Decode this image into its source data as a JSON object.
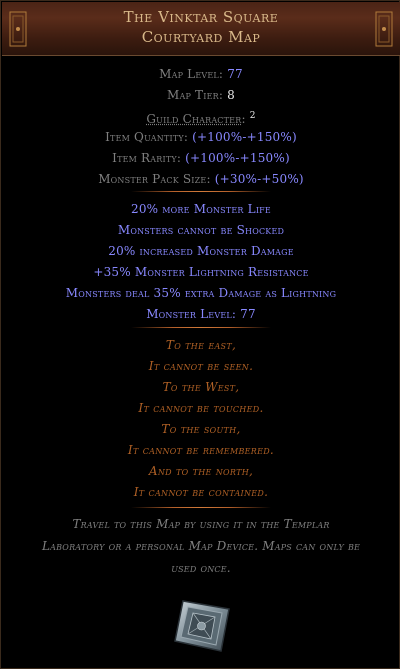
{
  "title": {
    "line1": "The Vinktar Square",
    "line2": "Courtyard Map"
  },
  "properties": [
    {
      "label": "Map Level: ",
      "value": "77",
      "value_color": "blue"
    },
    {
      "label": "Map Tier: ",
      "value": "8",
      "value_color": "white"
    },
    {
      "label": "Guild Character",
      "value": "2",
      "kind": "guild"
    },
    {
      "label": "Item Quantity: ",
      "value": "(+100%-+150%)",
      "value_color": "blue"
    },
    {
      "label": "Item Rarity: ",
      "value": "(+100%-+150%)",
      "value_color": "blue"
    },
    {
      "label": "Monster Pack Size: ",
      "value": "(+30%-+50%)",
      "value_color": "blue"
    }
  ],
  "mods": [
    "20% more Monster Life",
    "Monsters cannot be Shocked",
    "20% increased Monster Damage",
    "+35% Monster Lightning Resistance",
    "Monsters deal 35% extra Damage as Lightning",
    "Monster Level: 77"
  ],
  "flavour": [
    "To the east,",
    "It cannot be seen.",
    "To the West,",
    "It cannot be touched.",
    "To the south,",
    "It cannot be remembered.",
    "And to the north,",
    "It cannot be contained."
  ],
  "description": [
    "Travel to this Map by using it in the Templar",
    "Laboratory or a personal Map Device. Maps can only be",
    "used once."
  ],
  "colors": {
    "title": "#d9b98a",
    "label": "#7f7f7f",
    "magic": "#8888ff",
    "flavour": "#af6025",
    "separator": "#d07a3a"
  },
  "icon": "map-item-icon"
}
